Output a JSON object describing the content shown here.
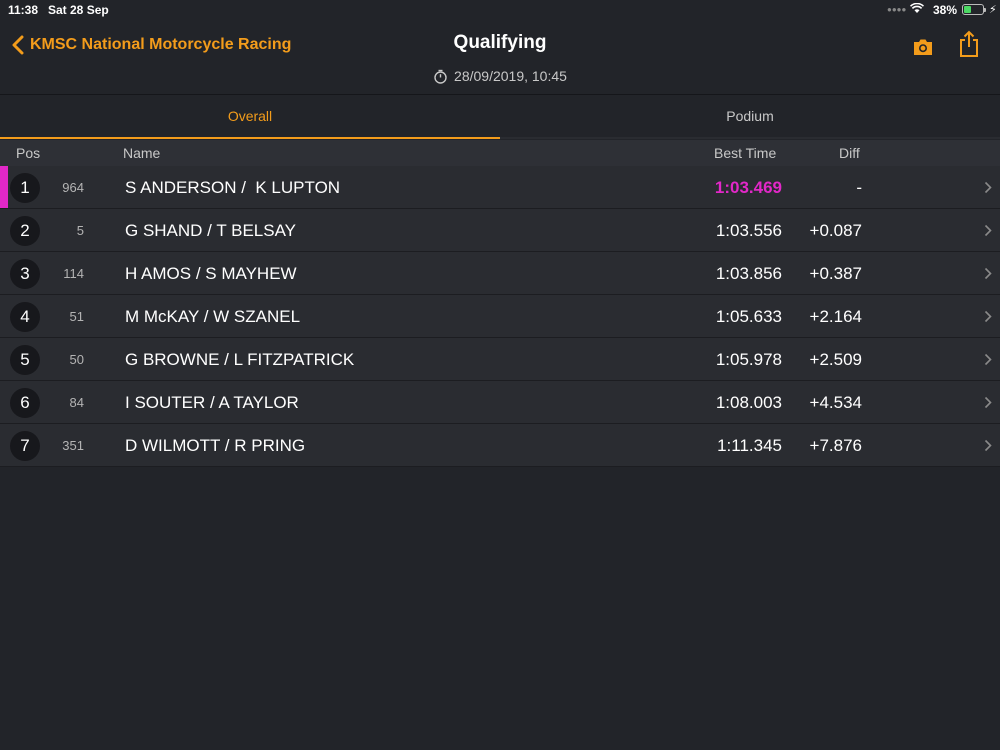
{
  "status_bar": {
    "time": "11:38",
    "date": "Sat 28 Sep",
    "battery": "38%",
    "battery_level": 0.38
  },
  "header": {
    "back_label": "KMSC National Motorcycle Racing",
    "title": "Qualifying",
    "datetime": "28/09/2019, 10:45",
    "icons": [
      "chevron-left-icon",
      "stopwatch-icon",
      "camera-icon",
      "share-icon"
    ]
  },
  "tabs": [
    {
      "label": "Overall",
      "active": true
    },
    {
      "label": "Podium",
      "active": false
    }
  ],
  "columns": {
    "pos": "Pos",
    "name": "Name",
    "best_time": "Best Time",
    "diff": "Diff"
  },
  "colors": {
    "accent": "#f39c1b",
    "fastest": "#e228c8",
    "background": "#222429",
    "row": "#2a2c31"
  },
  "results": [
    {
      "pos": "1",
      "number": "964",
      "name": "S ANDERSON /  K LUPTON",
      "best_time": "1:03.469",
      "diff": "-",
      "fastest": true
    },
    {
      "pos": "2",
      "number": "5",
      "name": "G SHAND / T BELSAY",
      "best_time": "1:03.556",
      "diff": "+0.087",
      "fastest": false
    },
    {
      "pos": "3",
      "number": "114",
      "name": "H AMOS / S MAYHEW",
      "best_time": "1:03.856",
      "diff": "+0.387",
      "fastest": false
    },
    {
      "pos": "4",
      "number": "51",
      "name": "M McKAY / W SZANEL",
      "best_time": "1:05.633",
      "diff": "+2.164",
      "fastest": false
    },
    {
      "pos": "5",
      "number": "50",
      "name": "G BROWNE / L FITZPATRICK",
      "best_time": "1:05.978",
      "diff": "+2.509",
      "fastest": false
    },
    {
      "pos": "6",
      "number": "84",
      "name": "I SOUTER / A TAYLOR",
      "best_time": "1:08.003",
      "diff": "+4.534",
      "fastest": false
    },
    {
      "pos": "7",
      "number": "351",
      "name": "D WILMOTT / R PRING",
      "best_time": "1:11.345",
      "diff": "+7.876",
      "fastest": false
    }
  ]
}
